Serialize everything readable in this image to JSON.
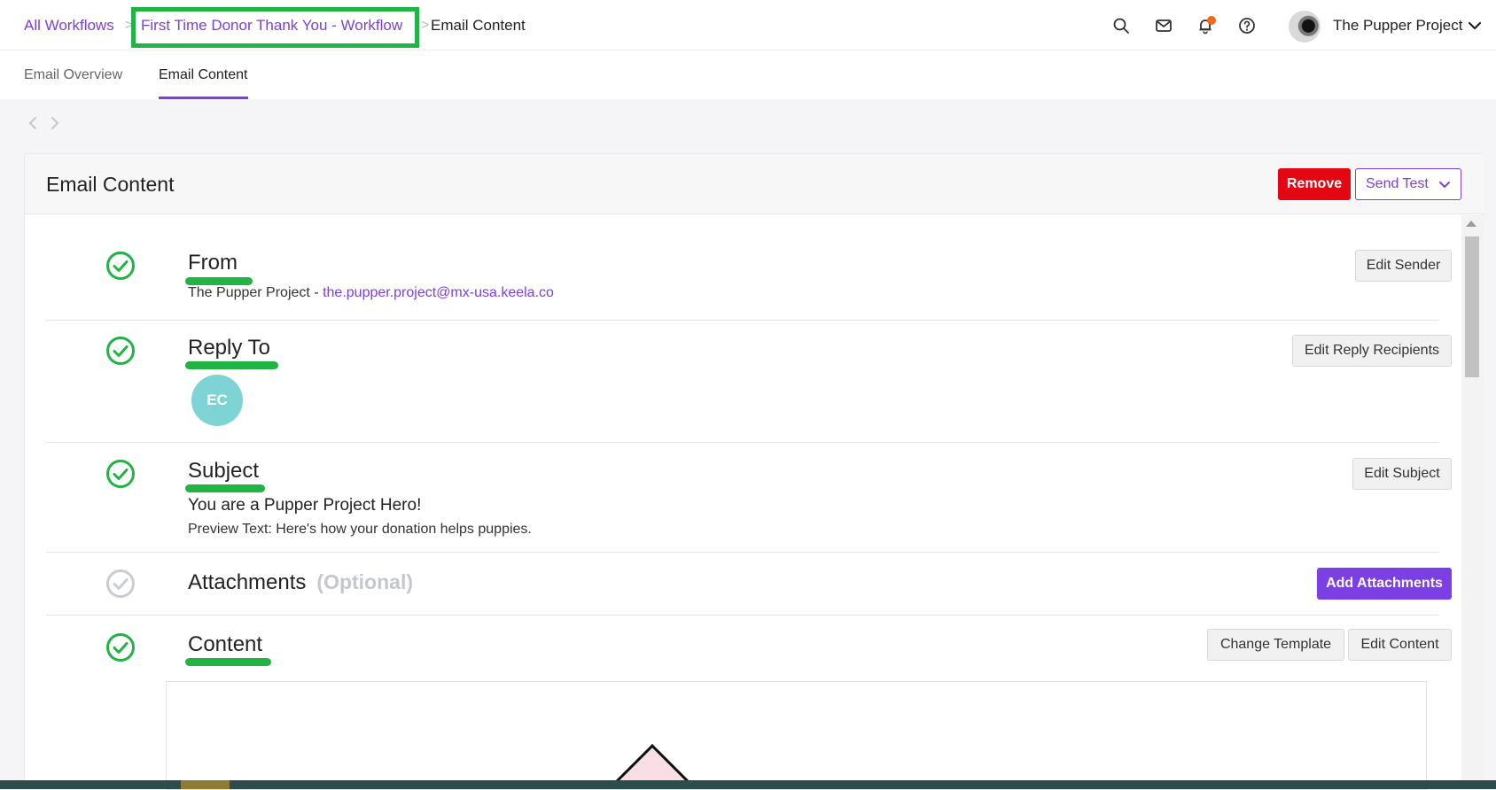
{
  "breadcrumb": {
    "all_workflows": "All Workflows",
    "separator": ">",
    "workflow": "First Time Donor Thank You - Workflow",
    "separator2": ">",
    "current": "Email Content"
  },
  "header": {
    "icons": [
      "search-icon",
      "mail-icon",
      "bell-icon",
      "help-icon"
    ],
    "org_name": "The Pupper Project"
  },
  "tabs": [
    {
      "label": "Email Overview",
      "active": false
    },
    {
      "label": "Email Content",
      "active": true
    }
  ],
  "panel": {
    "title": "Email Content",
    "remove_label": "Remove",
    "send_test_label": "Send Test"
  },
  "sections": {
    "from": {
      "title": "From",
      "sender_name": "The Pupper Project - ",
      "sender_email": "the.pupper.project@mx-usa.keela.co",
      "button": "Edit Sender"
    },
    "reply_to": {
      "title": "Reply To",
      "avatar_initials": "EC",
      "button": "Edit Reply Recipients"
    },
    "subject": {
      "title": "Subject",
      "subject_text": "You are a Pupper Project Hero!",
      "preview_text": "Preview Text: Here's how your donation helps puppies.",
      "button": "Edit Subject"
    },
    "attachments": {
      "title": "Attachments",
      "optional": "(Optional)",
      "button": "Add Attachments"
    },
    "content": {
      "title": "Content",
      "change_template": "Change Template",
      "edit_content": "Edit Content"
    }
  },
  "colors": {
    "accent": "#7b3fe4",
    "danger": "#e30613",
    "success": "#22b345",
    "muted_check": "#c9ccd2",
    "avatar_bg": "#7ed4d5"
  }
}
